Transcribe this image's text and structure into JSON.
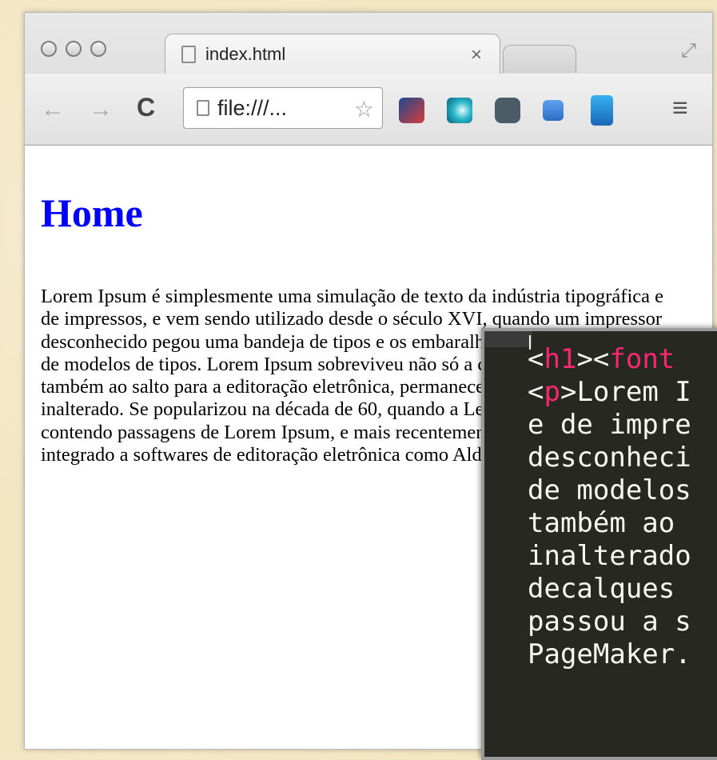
{
  "browser": {
    "tab": {
      "title": "index.html",
      "close": "×"
    },
    "toolbar": {
      "back": "←",
      "forward": "→",
      "reload": "C",
      "url": "file:///...",
      "star": "☆",
      "menu": "≡"
    },
    "extensions": [
      "speed-dial-icon",
      "swirl-icon",
      "pocket-icon",
      "calendar-icon",
      "speaker-icon"
    ]
  },
  "page": {
    "heading": "Home",
    "paragraph": "Lorem Ipsum é simplesmente uma simulação de texto da indústria tipográfica e de impressos, e vem sendo utilizado desde o século XVI, quando um impressor desconhecido pegou uma bandeja de tipos e os embaralhou para fazer um livro de modelos de tipos. Lorem Ipsum sobreviveu não só a cinco séculos, como também ao salto para a editoração eletrônica, permanecendo essencialmente inalterado. Se popularizou na década de 60, quando a Letraset lançou decalques contendo passagens de Lorem Ipsum, e mais recentemente quando passou a ser integrado a softwares de editoração eletrônica como Aldus PageMaker."
  },
  "editor": {
    "lines": [
      {
        "tag1": "h1",
        "tag2": "font",
        "text": ""
      },
      {
        "tag": "p",
        "text": "Lorem I"
      },
      {
        "text": "e de impre"
      },
      {
        "text": "desconheci"
      },
      {
        "text": "de modelos"
      },
      {
        "text": "também ao "
      },
      {
        "text": "inalterado"
      },
      {
        "text": "decalques "
      },
      {
        "text": "passou a s"
      },
      {
        "text": "PageMaker."
      }
    ]
  },
  "colors": {
    "heading": "#0000ff",
    "editor_bg": "#272822",
    "editor_tag": "#f92672",
    "editor_text": "#f8f8f2"
  }
}
